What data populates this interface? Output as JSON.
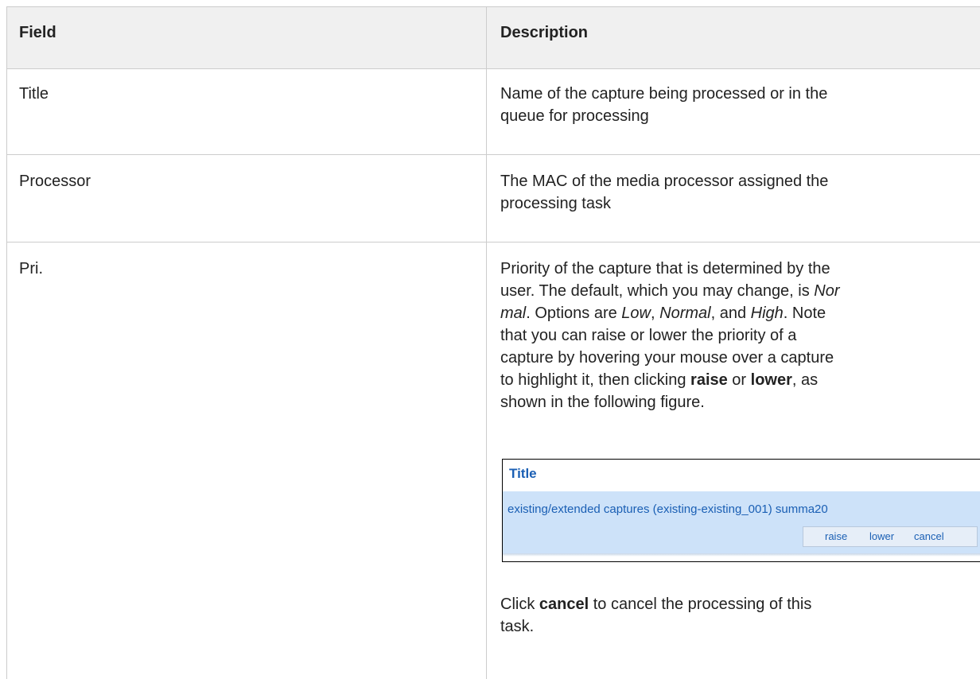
{
  "table": {
    "headers": {
      "field": "Field",
      "description": "Description"
    },
    "rows": [
      {
        "field": "Title",
        "description_lines": [
          "Name of the capture being processed or in the",
          "queue for processing"
        ]
      },
      {
        "field": "Processor",
        "description_lines": [
          "The MAC of the media processor assigned the",
          "processing task"
        ]
      },
      {
        "field": "Pri.",
        "description": {
          "l1": "Priority of the capture that is determined by the",
          "l2": "user. The default, which you may change, is ",
          "l2_italic": "Nor",
          "l3_italic": "mal",
          "l3_a": ". Options are ",
          "l3_low": "Low",
          "l3_b": ", ",
          "l3_normal": "Normal",
          "l3_c": ", and ",
          "l3_high": "High",
          "l3_d": ". Note",
          "l4": "that you can raise or lower the priority of a",
          "l5": "capture by hovering your mouse over a capture",
          "l6_a": "to highlight it, then clicking ",
          "l6_raise": "raise",
          "l6_b": " or ",
          "l6_lower": "lower",
          "l6_c": ", as",
          "l7": "shown in the following figure."
        },
        "figure": {
          "title": "Title",
          "row_text": "existing/extended captures (existing-existing_001) summa20",
          "actions": {
            "raise": "raise",
            "lower": "lower",
            "cancel": "cancel"
          }
        },
        "after_figure": {
          "a": "Click ",
          "bold": "cancel",
          "b": " to cancel the processing of this",
          "l2": "task."
        }
      }
    ]
  }
}
